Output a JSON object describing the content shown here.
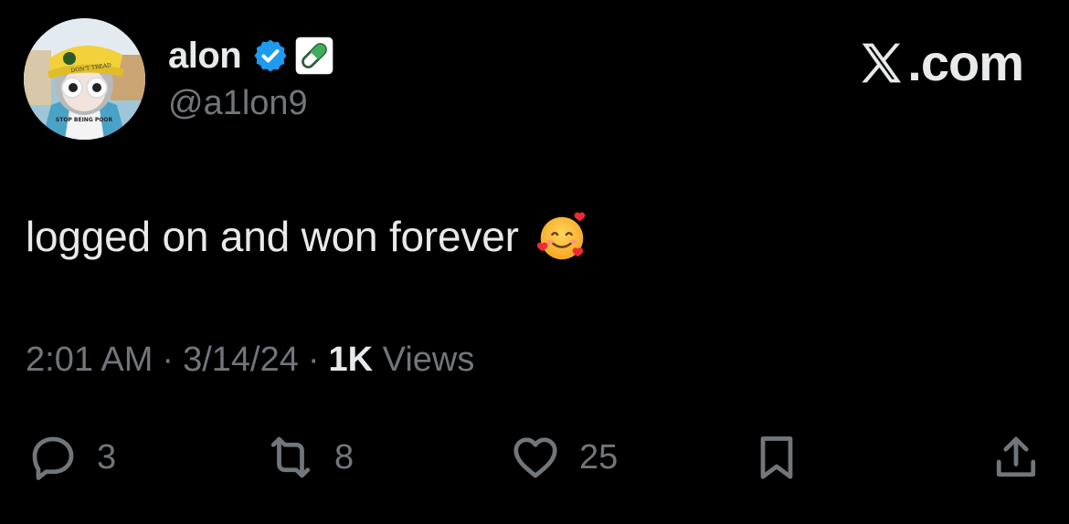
{
  "author": {
    "display_name": "alon",
    "handle": "@a1lon9",
    "verified_color": "#1d9bf0",
    "avatar_hat_text": "DON'T TREAD",
    "avatar_shirt_text": "STOP BEING POOR"
  },
  "brand": {
    "label": ".com",
    "icon": "x-logo-icon"
  },
  "tweet": {
    "text": "logged on and won forever",
    "emoji": "smiling-face-with-hearts-icon"
  },
  "meta": {
    "time": "2:01 AM",
    "separator": "·",
    "date": "3/14/24",
    "views_count": "1K",
    "views_label": "Views"
  },
  "actions": {
    "replies": "3",
    "reposts": "8",
    "likes": "25"
  },
  "colors": {
    "background": "#000000",
    "primary_text": "#e7e9ea",
    "secondary_text": "#71767b"
  }
}
